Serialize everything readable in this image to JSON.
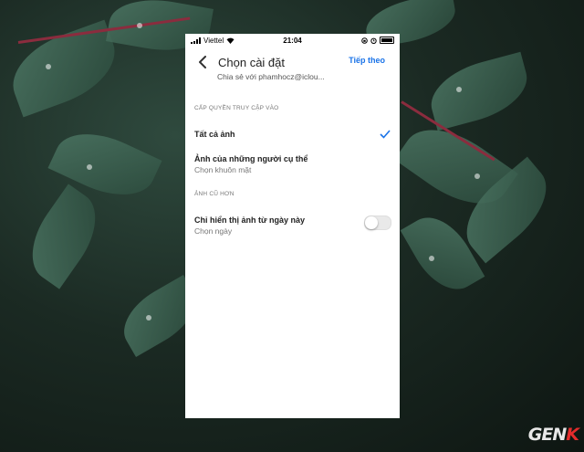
{
  "status_bar": {
    "carrier": "Viettel",
    "time": "21:04"
  },
  "header": {
    "title": "Chọn cài đặt",
    "action": "Tiếp theo",
    "subtitle": "Chia sẻ với phamhocz@iclou..."
  },
  "sections": [
    {
      "label": "CẤP QUYỀN TRUY CẬP VÀO"
    },
    {
      "label": "ẢNH CŨ HƠN"
    }
  ],
  "options": {
    "all_photos": {
      "label": "Tất cả ảnh",
      "selected": true
    },
    "specific_people": {
      "label": "Ảnh của những người cụ thể",
      "sub": "Chọn khuôn mặt"
    },
    "from_date": {
      "label": "Chỉ hiển thị ảnh từ ngày này",
      "sub": "Chọn ngày",
      "enabled": false
    }
  },
  "icons": {
    "back": "back-arrow-icon",
    "check": "checkmark-icon",
    "signal": "signal-icon",
    "wifi": "wifi-icon",
    "alarm": "alarm-icon",
    "battery": "battery-icon"
  },
  "colors": {
    "accent": "#1a73e8",
    "logo_red": "#e42c2c"
  },
  "watermark": {
    "part1": "GEN",
    "part2": "K"
  }
}
